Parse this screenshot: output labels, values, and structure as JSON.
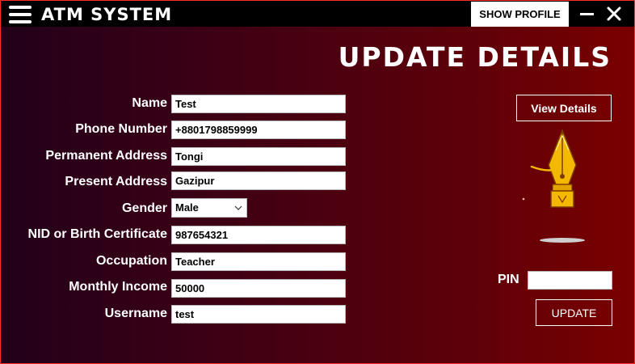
{
  "titlebar": {
    "app_title": "ATM SYSTEM",
    "show_profile_label": "SHOW PROFILE",
    "menu_icon": "hamburger-menu-icon",
    "minimize_icon": "minimize-icon",
    "close_icon": "close-icon"
  },
  "page": {
    "title": "UPDATE DETAILS"
  },
  "form": {
    "fields": [
      {
        "label": "Name",
        "value": "Test"
      },
      {
        "label": "Phone Number",
        "value": "+8801798859999"
      },
      {
        "label": "Permanent Address",
        "value": "Tongi"
      },
      {
        "label": "Present Address",
        "value": "Gazipur"
      },
      {
        "label": "Gender",
        "value": "Male"
      },
      {
        "label": "NID or Birth Certificate",
        "value": "987654321"
      },
      {
        "label": "Occupation",
        "value": "Teacher"
      },
      {
        "label": "Monthly Income",
        "value": "50000"
      },
      {
        "label": "Username",
        "value": "test"
      }
    ]
  },
  "side": {
    "view_details_label": "View Details",
    "illustration_icon": "fountain-pen-icon",
    "pin_label": "PIN",
    "pin_value": "",
    "update_label": "UPDATE"
  },
  "colors": {
    "gradient_start": "#22001a",
    "gradient_end": "#7a0000",
    "border": "#ff2a2a",
    "pen_gold": "#f5b800"
  }
}
